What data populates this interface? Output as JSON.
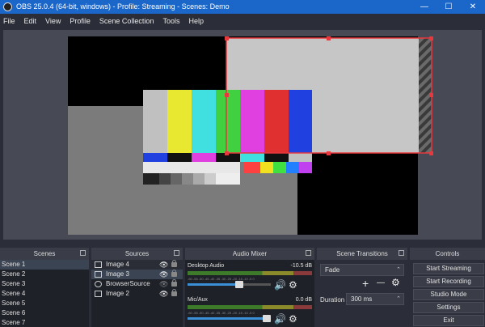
{
  "window": {
    "title": "OBS 25.0.4 (64-bit, windows) - Profile: Streaming - Scenes: Demo",
    "minimize_glyph": "—",
    "maximize_glyph": "☐",
    "close_glyph": "✕"
  },
  "menu": [
    "File",
    "Edit",
    "View",
    "Profile",
    "Scene Collection",
    "Tools",
    "Help"
  ],
  "scenes": {
    "header": "Scenes",
    "items": [
      "Scene 1",
      "Scene 2",
      "Scene 3",
      "Scene 4",
      "Scene 5",
      "Scene 6",
      "Scene 7"
    ],
    "selected_index": 0
  },
  "sources": {
    "header": "Sources",
    "items": [
      {
        "label": "Image 4",
        "icon": "image-icon"
      },
      {
        "label": "Image 3",
        "icon": "image-icon"
      },
      {
        "label": "BrowserSource",
        "icon": "globe-icon"
      },
      {
        "label": "Image 2",
        "icon": "image-icon"
      }
    ]
  },
  "audio_mixer": {
    "header": "Audio Mixer",
    "channels": [
      {
        "name": "Desktop Audio",
        "db": "-10.5 dB",
        "volume": 0.62
      },
      {
        "name": "Mic/Aux",
        "db": "0.0 dB",
        "volume": 1.0
      }
    ],
    "ticks": "-60 -55 -50 -45 -40 -35 -30 -25 -20 -15 -10 -5 0"
  },
  "scene_transitions": {
    "header": "Scene Transitions",
    "transition": "Fade",
    "duration_label": "Duration",
    "duration_value": "300 ms",
    "add_glyph": "+",
    "remove_glyph": "—"
  },
  "controls": {
    "header": "Controls",
    "buttons": [
      "Start Streaming",
      "Start Recording",
      "Studio Mode",
      "Settings",
      "Exit"
    ]
  },
  "colors": {
    "titlebar": "#1a66c9",
    "selection_outline": "#e8383d",
    "accent": "#3b8fd6"
  },
  "icons": {
    "eye": "👁",
    "speaker": "🔊",
    "gear": "⚙"
  }
}
